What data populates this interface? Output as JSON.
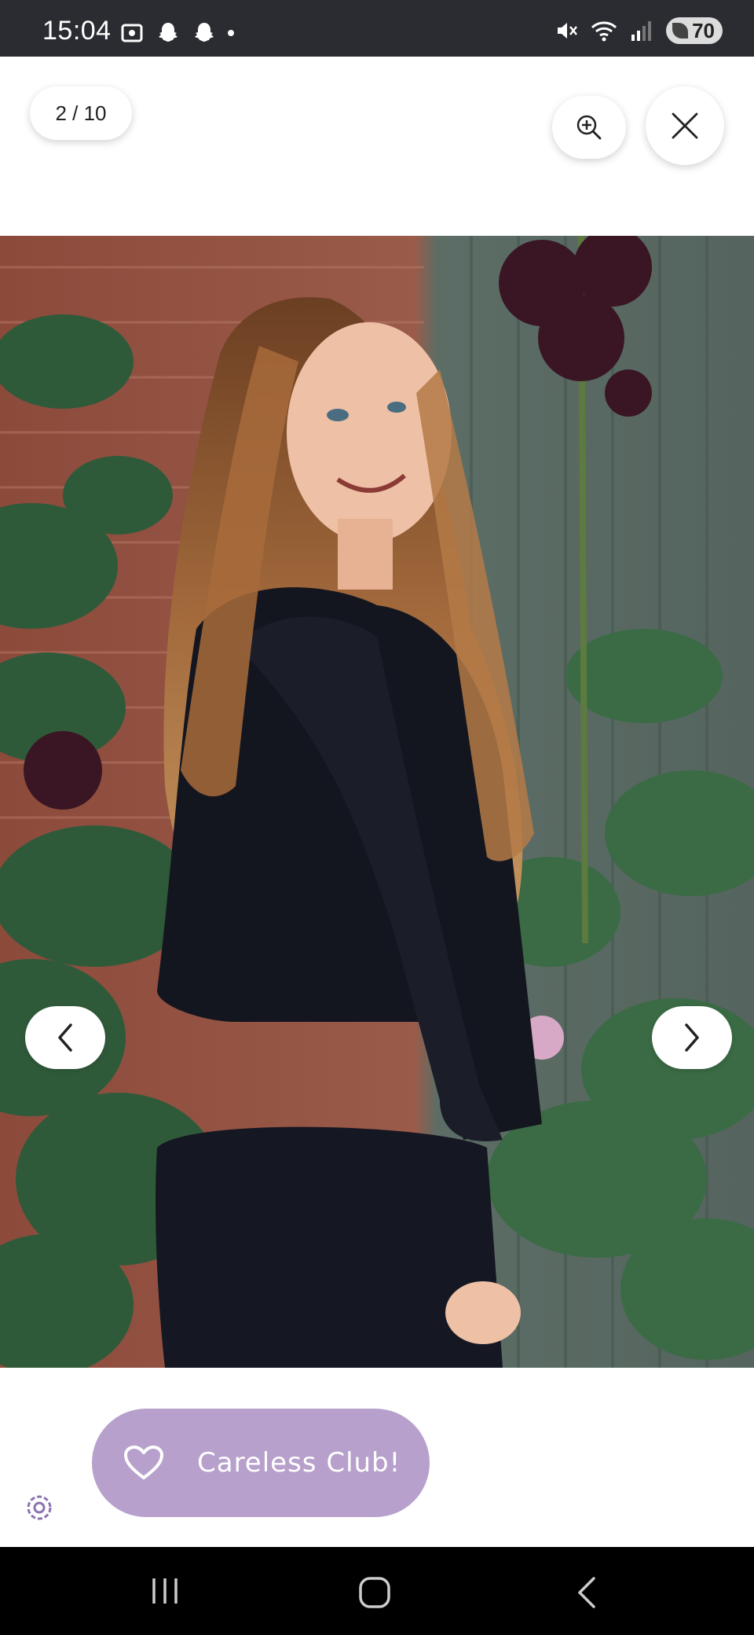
{
  "status_bar": {
    "time": "15:04",
    "battery": "70",
    "left_icons": [
      "screenshot-icon",
      "snapchat-icon",
      "snapchat-icon",
      "dot-icon"
    ],
    "right_icons": [
      "mute-icon",
      "wifi-icon",
      "signal-icon",
      "battery-icon"
    ]
  },
  "viewer": {
    "counter": "2 / 10",
    "zoom_icon": "zoom-in-icon",
    "close_icon": "close-icon",
    "prev_icon": "chevron-left-icon",
    "next_icon": "chevron-right-icon"
  },
  "promo": {
    "label": "Careless Club!",
    "icon": "heart-icon",
    "color": "#b7a0cc"
  },
  "system_nav": {
    "buttons": [
      "recent-apps-icon",
      "home-icon",
      "back-icon"
    ]
  }
}
